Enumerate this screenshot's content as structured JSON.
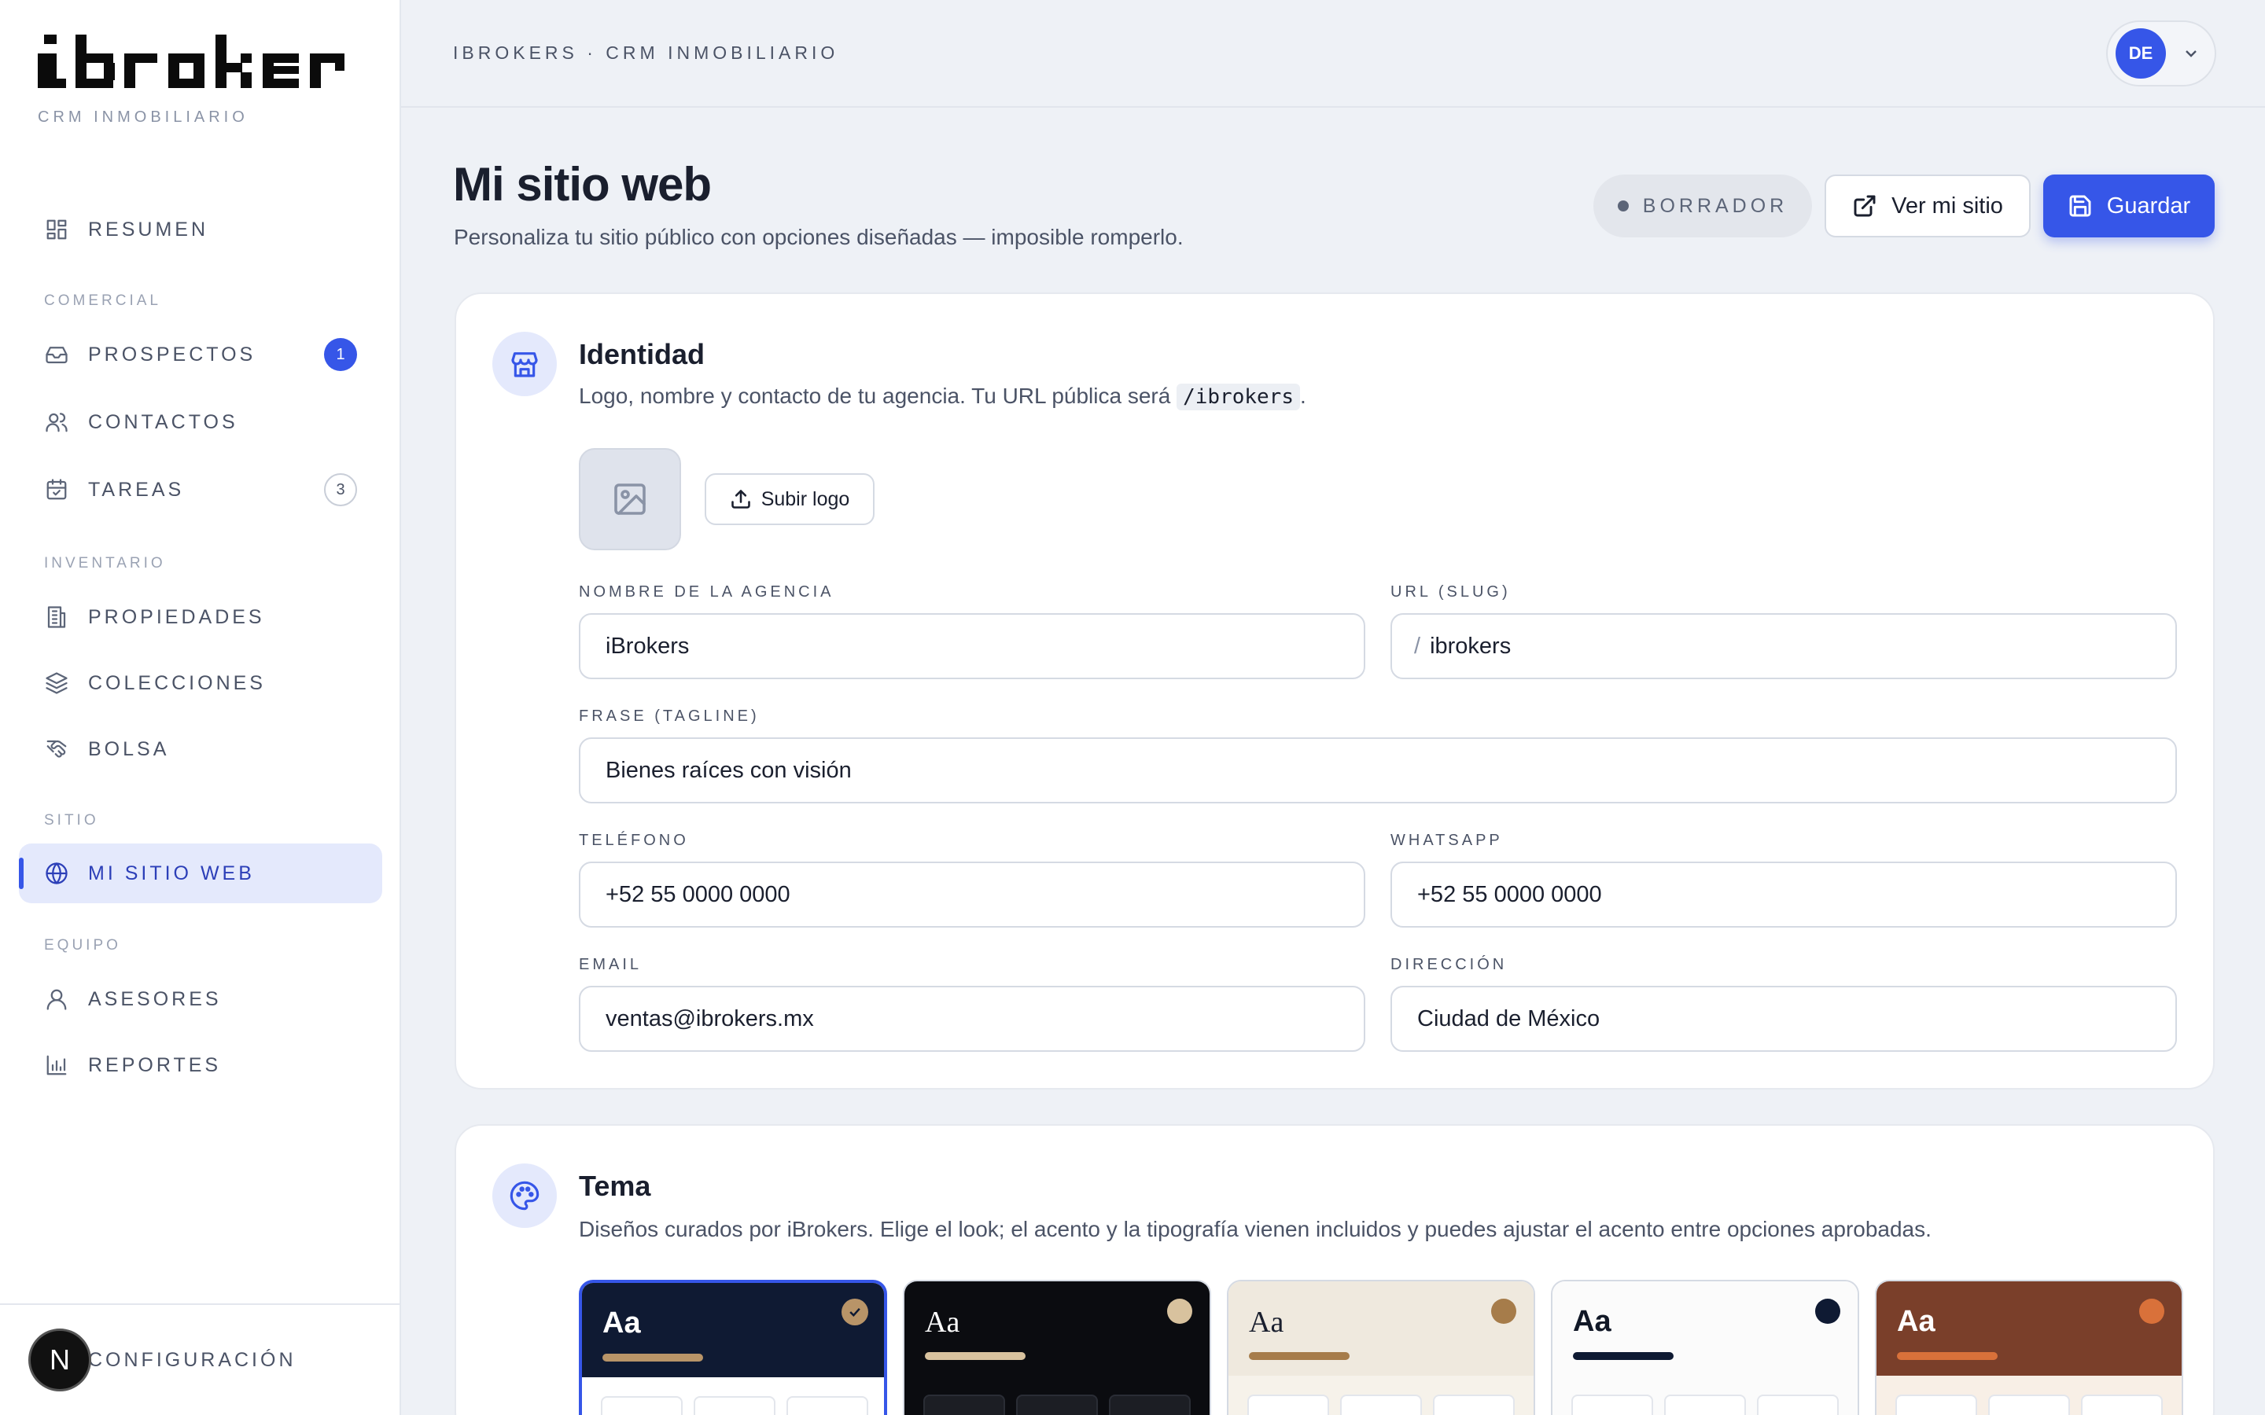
{
  "app": {
    "logo_text": "ibroker",
    "logo_sub": "CRM INMOBILIARIO"
  },
  "sidebar": {
    "sections": {
      "comercial": "COMERCIAL",
      "inventario": "INVENTARIO",
      "sitio": "SITIO",
      "equipo": "EQUIPO"
    },
    "items": [
      {
        "label": "RESUMEN",
        "icon": "dashboard-icon"
      },
      {
        "label": "PROSPECTOS",
        "icon": "inbox-icon",
        "badge": "1"
      },
      {
        "label": "CONTACTOS",
        "icon": "users-icon"
      },
      {
        "label": "TAREAS",
        "icon": "calendar-check-icon",
        "badge": "3"
      },
      {
        "label": "PROPIEDADES",
        "icon": "building-icon"
      },
      {
        "label": "COLECCIONES",
        "icon": "layers-icon"
      },
      {
        "label": "BOLSA",
        "icon": "handshake-icon"
      },
      {
        "label": "MI SITIO WEB",
        "icon": "globe-icon",
        "active": true
      },
      {
        "label": "ASESORES",
        "icon": "user-icon"
      },
      {
        "label": "REPORTES",
        "icon": "bar-chart-icon"
      }
    ],
    "footer": {
      "avatar": "N",
      "label": "CONFIGURACIÓN"
    }
  },
  "topbar": {
    "breadcrumb": "IBROKERS · CRM INMOBILIARIO",
    "user_initials": "DE"
  },
  "header": {
    "title": "Mi sitio web",
    "subtitle": "Personaliza tu sitio público con opciones diseñadas — imposible romperlo.",
    "status": "BORRADOR",
    "view_label": "Ver mi sitio",
    "save_label": "Guardar"
  },
  "identity": {
    "title": "Identidad",
    "desc_before": "Logo, nombre y contacto de tu agencia. Tu URL pública será ",
    "desc_code": "/ibrokers",
    "desc_after": ".",
    "upload_label": "Subir logo",
    "fields": {
      "agency_label": "NOMBRE DE LA AGENCIA",
      "agency_value": "iBrokers",
      "slug_label": "URL (SLUG)",
      "slug_prefix": "/",
      "slug_value": "ibrokers",
      "tagline_label": "FRASE (TAGLINE)",
      "tagline_value": "Bienes raíces con visión",
      "phone_label": "TELÉFONO",
      "phone_value": "+52 55 0000 0000",
      "whatsapp_label": "WHATSAPP",
      "whatsapp_value": "+52 55 0000 0000",
      "email_label": "EMAIL",
      "email_value": "ventas@ibrokers.mx",
      "address_label": "DIRECCIÓN",
      "address_value": "Ciudad de México"
    }
  },
  "theme": {
    "title": "Tema",
    "desc": "Diseños curados por iBrokers. Elige el look; el acento y la tipografía vienen incluidos y puedes ajustar el acento entre opciones aprobadas.",
    "sample": "Aa",
    "options": [
      {
        "top": "#0f1a33",
        "text": "#ffffff",
        "accent": "#b89468",
        "bottom": "#ffffff",
        "mini": "#ffffff",
        "selected": true
      },
      {
        "top": "#0b0c10",
        "text": "#ffffff",
        "accent": "#d8c29e",
        "bottom": "#0b0c10",
        "mini": "#1c1e24"
      },
      {
        "top": "#efe9de",
        "text": "#1a1f2e",
        "accent": "#a67c4a",
        "bottom": "#f6f2ea",
        "mini": "#ffffff"
      },
      {
        "top": "#fbfbfb",
        "text": "#111827",
        "accent": "#0f1a33",
        "bottom": "#fbfbfb",
        "mini": "#ffffff"
      },
      {
        "top": "#7a3f2a",
        "text": "#ffffff",
        "accent": "#d9713a",
        "bottom": "#f8efe6",
        "mini": "#ffffff"
      }
    ]
  },
  "colors": {
    "accent": "#3656e8",
    "active_bg": "#e4e9fc"
  }
}
